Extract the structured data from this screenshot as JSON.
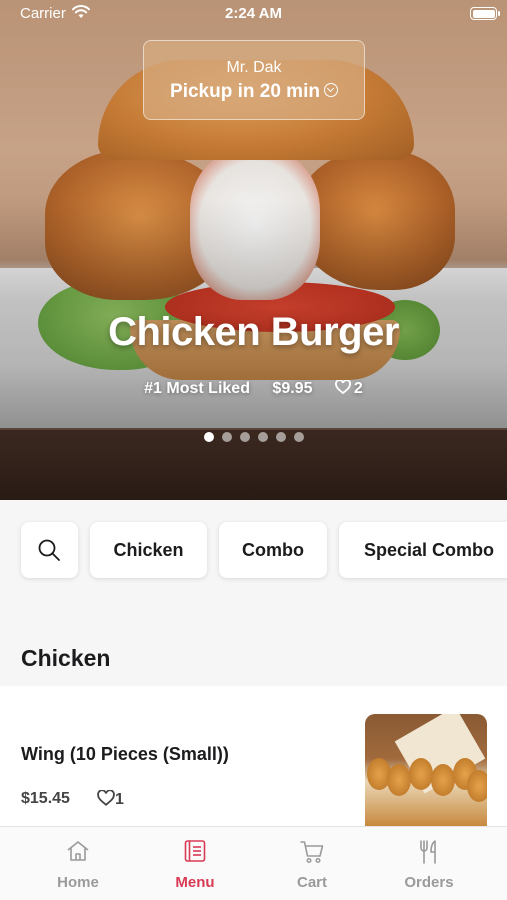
{
  "status_bar": {
    "carrier": "Carrier",
    "time": "2:24 AM"
  },
  "pickup": {
    "shop_name": "Mr. Dak",
    "eta_text": "Pickup in 20 min"
  },
  "featured": {
    "title": "Chicken Burger",
    "rank": "#1 Most Liked",
    "price": "$9.95",
    "likes": "2",
    "carousel_pages": 6,
    "carousel_active_index": 0
  },
  "categories": [
    "Chicken",
    "Combo",
    "Special Combo"
  ],
  "section": {
    "title": "Chicken"
  },
  "menu_items": [
    {
      "name": "Wing (10 Pieces (Small))",
      "price": "$15.45",
      "likes": "1"
    }
  ],
  "tabs": [
    {
      "label": "Home",
      "icon": "home-icon"
    },
    {
      "label": "Menu",
      "icon": "menu-icon"
    },
    {
      "label": "Cart",
      "icon": "cart-icon"
    },
    {
      "label": "Orders",
      "icon": "orders-icon"
    }
  ],
  "colors": {
    "accent": "#d93a54",
    "inactive_tab": "#9a9a9a"
  }
}
